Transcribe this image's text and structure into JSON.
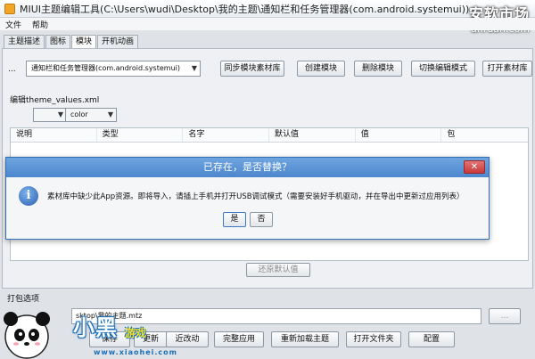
{
  "window": {
    "title": "MIUI主题编辑工具(C:\\Users\\wudi\\Desktop\\我的主题\\通知栏和任务管理器(com.android.systemui))",
    "watermark_big": "安软市场",
    "watermark_small": "anruan.com"
  },
  "menu": {
    "file": "文件",
    "help": "帮助"
  },
  "tabs": [
    "主题描述",
    "图标",
    "模块",
    "开机动画"
  ],
  "toolbar": {
    "dots": "...",
    "module_select": "通知栏和任务管理器(com.android.systemui)",
    "sync_lib": "同步模块素材库",
    "create_module": "创建模块",
    "delete_module": "删除模块",
    "switch_mode": "切换编辑模式",
    "open_material": "打开素材库"
  },
  "editor": {
    "label": "编辑theme_values.xml",
    "type_select": "",
    "kind_select": "color",
    "columns": [
      "说明",
      "类型",
      "名字",
      "默认值",
      "值",
      "包"
    ],
    "reset_button": "还原默认值"
  },
  "pack": {
    "label": "打包选项",
    "path": "sktop\\我的主题.mtz",
    "browse": "...",
    "buttons": [
      "保存",
      "更新",
      "近改动",
      "完整应用",
      "重新加载主题",
      "打开文件夹",
      "配置"
    ]
  },
  "dialog": {
    "title": "已存在，是否替换？",
    "close": "✕",
    "icon_glyph": "i",
    "message": "素材库中缺少此App资源。即将导入，请插上手机并打开USB调试模式（需要安装好手机驱动，并在导出中更新过应用列表）",
    "yes": "是",
    "no": "否"
  },
  "logo": {
    "main": "小黑",
    "sub": "游戏",
    "url": "www.xiaohei.com"
  }
}
